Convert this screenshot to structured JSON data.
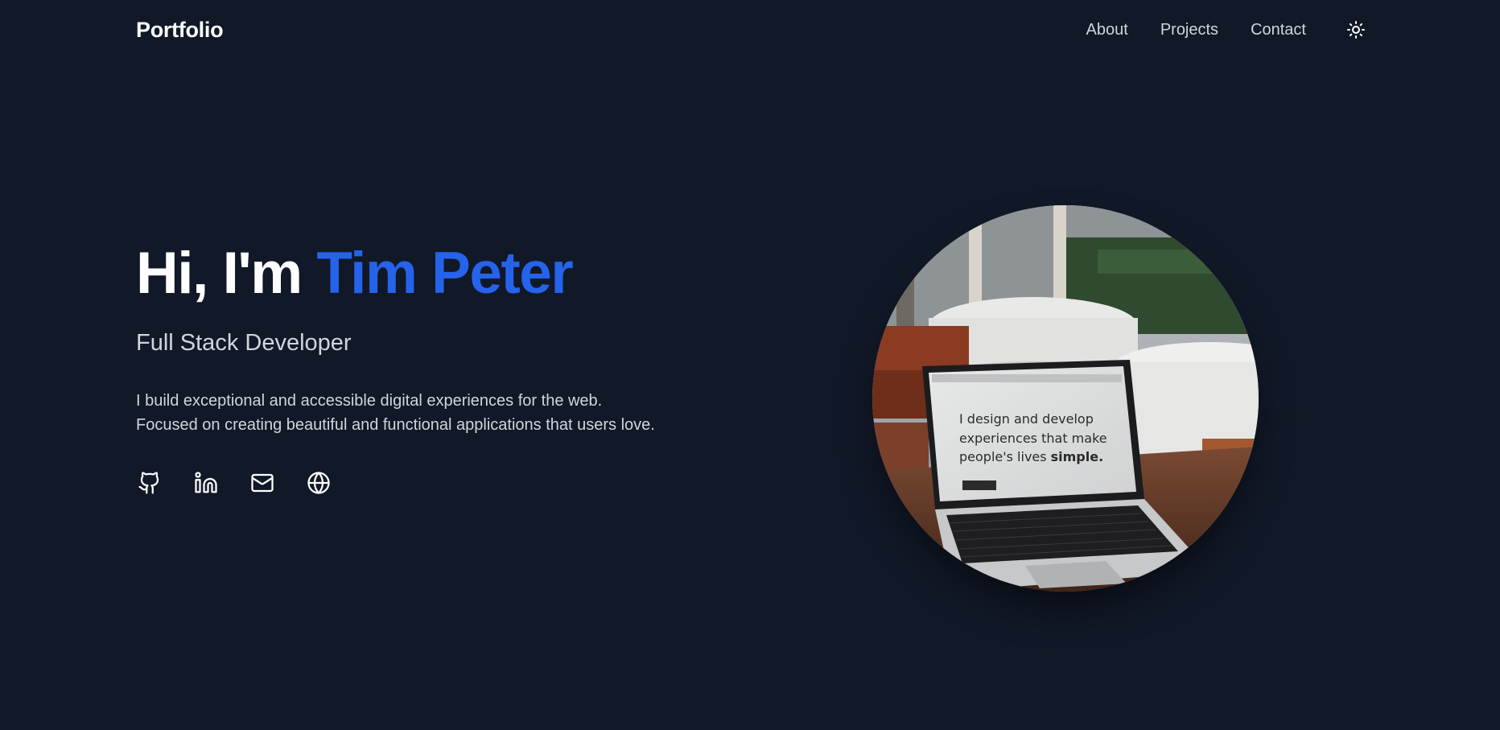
{
  "nav": {
    "brand": "Portfolio",
    "links": [
      {
        "label": "About"
      },
      {
        "label": "Projects"
      },
      {
        "label": "Contact"
      }
    ],
    "theme_toggle_icon": "sun-icon"
  },
  "hero": {
    "greeting": "Hi, I'm ",
    "name": "Tim Peter",
    "role": "Full Stack Developer",
    "bio": "I build exceptional and accessible digital experiences for the web. Focused on creating beautiful and functional applications that users love.",
    "socials": [
      {
        "icon": "github-icon"
      },
      {
        "icon": "linkedin-icon"
      },
      {
        "icon": "mail-icon"
      },
      {
        "icon": "globe-icon"
      }
    ],
    "photo": {
      "screen_text_line1": "I design and develop",
      "screen_text_line2": "experiences that make",
      "screen_text_line3": "people's lives",
      "screen_text_bold": "simple."
    }
  },
  "colors": {
    "background": "#111827",
    "accent": "#2563eb",
    "text": "#ffffff",
    "muted": "#d1d5db"
  }
}
